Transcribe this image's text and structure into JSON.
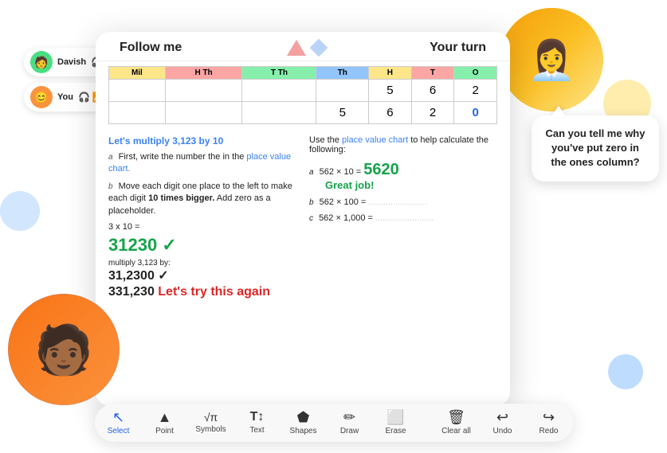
{
  "header": {
    "follow_me": "Follow me",
    "your_turn": "Your turn"
  },
  "users": [
    {
      "name": "Davish",
      "emoji": "🎧"
    },
    {
      "name": "You",
      "emoji": "🎧"
    }
  ],
  "place_value_table": {
    "headers": [
      "Mil",
      "H Th",
      "T Th",
      "Th",
      "H",
      "T",
      "O"
    ],
    "rows": [
      [
        "",
        "",
        "",
        "",
        "5",
        "6",
        "2"
      ],
      [
        "",
        "",
        "",
        "",
        "5",
        "6",
        "2",
        "0"
      ]
    ]
  },
  "left_section": {
    "title": "Let's multiply 3,123 by 10",
    "steps": [
      {
        "label": "a",
        "text": "First, write the number the in the place value chart."
      },
      {
        "label": "b",
        "text": "Move each digit one place to the left to make each digit 10 times bigger. Add zero as a placeholder."
      }
    ],
    "calc1": "3 x 10 = 31230",
    "calc1_display": "31230",
    "multiply_label": "multiply 3,123 by:",
    "calc2": "31,2300",
    "result": "331,230",
    "retry": "Let's try this again"
  },
  "right_section": {
    "intro": "Use the place value chart to help calculate the following:",
    "problems": [
      {
        "label": "a",
        "problem": "562 × 10 =",
        "answer": "5620",
        "feedback": "Great job!"
      },
      {
        "label": "b",
        "problem": "562 × 100 =",
        "answer": ".................."
      },
      {
        "label": "c",
        "problem": "562 × 1,000 =",
        "answer": ".................."
      }
    ]
  },
  "speech_bubble": {
    "text": "Can you tell me why you've put zero in the ones column?"
  },
  "toolbar": {
    "items": [
      {
        "id": "select",
        "icon": "↖",
        "label": "Select",
        "active": true
      },
      {
        "id": "point",
        "icon": "▲",
        "label": "Point",
        "active": false
      },
      {
        "id": "symbols",
        "icon": "√π",
        "label": "Symbols",
        "active": false
      },
      {
        "id": "text",
        "icon": "T↕",
        "label": "Text",
        "active": false
      },
      {
        "id": "shapes",
        "icon": "⬟",
        "label": "Shapes",
        "active": false
      },
      {
        "id": "draw",
        "icon": "✏",
        "label": "Draw",
        "active": false
      },
      {
        "id": "erase",
        "icon": "⬜",
        "label": "Erase",
        "active": false
      },
      {
        "id": "clear_all",
        "icon": "🗑",
        "label": "Clear all",
        "active": false
      },
      {
        "id": "undo",
        "icon": "↩",
        "label": "Undo",
        "active": false
      },
      {
        "id": "redo",
        "icon": "↪",
        "label": "Redo",
        "active": false
      }
    ]
  }
}
